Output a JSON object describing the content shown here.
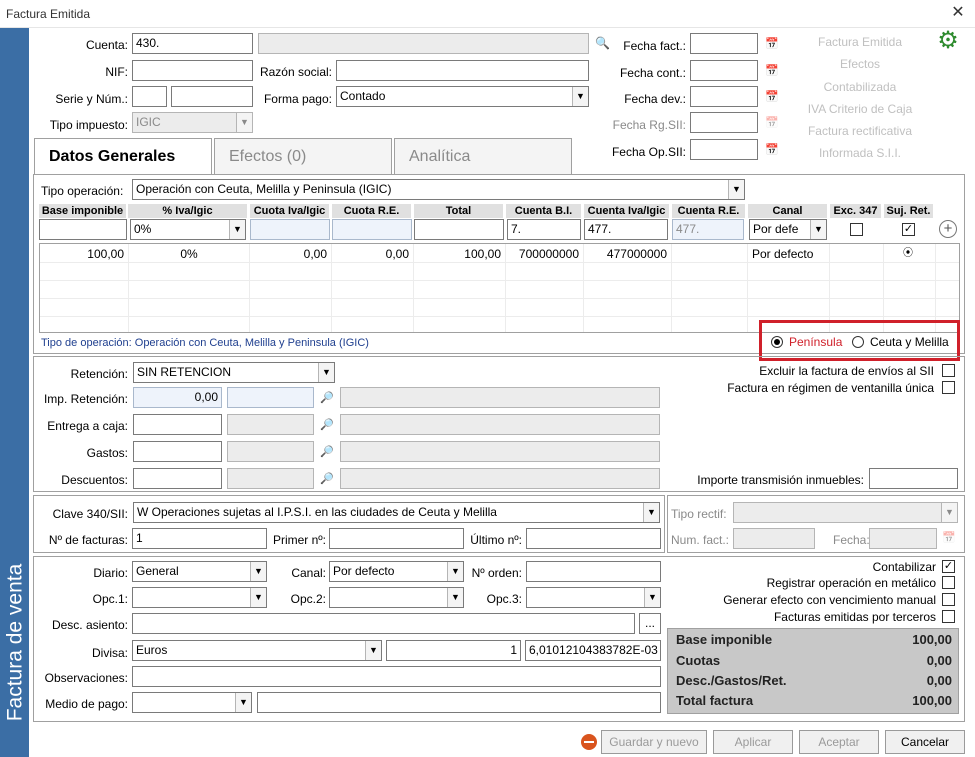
{
  "window": {
    "title": "Factura Emitida",
    "close": "✕"
  },
  "sidebar": {
    "label": "Factura de venta"
  },
  "header": {
    "cuenta_label": "Cuenta:",
    "cuenta_value": "430.",
    "nif_label": "NIF:",
    "razon_label": "Razón social:",
    "serie_label": "Serie y Núm.:",
    "forma_label": "Forma pago:",
    "forma_value": "Contado",
    "tipo_imp_label": "Tipo impuesto:",
    "tipo_imp_value": "IGIC"
  },
  "dates": {
    "fecha_fact": "Fecha  fact.:",
    "fecha_cont": "Fecha cont.:",
    "fecha_dev": "Fecha dev.:",
    "fecha_rg": "Fecha Rg.SII:",
    "fecha_op": "Fecha Op.SII:"
  },
  "right_links": [
    "Factura Emitida",
    "Efectos",
    "Contabilizada",
    "IVA Criterio de Caja",
    "Factura rectificativa",
    "Informada S.I.I."
  ],
  "tabs": [
    "Datos Generales",
    "Efectos  (0)",
    "Analítica"
  ],
  "tipo_operacion": {
    "label": "Tipo operación:",
    "value": "Operación con Ceuta, Melilla y Peninsula (IGIC)"
  },
  "grid": {
    "headers": [
      "Base imponible",
      "% Iva/Igic",
      "Cuota Iva/Igic",
      "Cuota R.E.",
      "Total",
      "Cuenta B.I.",
      "Cuenta Iva/Igic",
      "Cuenta R.E.",
      "Canal",
      "Exc. 347",
      "Suj. Ret."
    ],
    "edit": {
      "pct": "0%",
      "cuenta_bi": "7.",
      "cuenta_iva": "477.",
      "cuenta_re": "477.",
      "canal": "Por defe"
    },
    "row": [
      "100,00",
      "0%",
      "0,00",
      "0,00",
      "100,00",
      "700000000",
      "477000000",
      "Por defecto",
      "⦿"
    ]
  },
  "tipo_info": "Tipo de operación: Operación con Ceuta, Melilla y Peninsula (IGIC)",
  "radio": {
    "peninsula": "Península",
    "ceuta": "Ceuta y Melilla"
  },
  "retencion": {
    "label": "Retención:",
    "value": "SIN RETENCION",
    "imp_label": "Imp. Retención:",
    "imp_value": "0,00",
    "entrega_label": "Entrega a caja:",
    "gastos_label": "Gastos:",
    "desc_label": "Descuentos:"
  },
  "checks_mid": {
    "excluir": "Excluir la factura de envíos al SII",
    "ventanilla": "Factura en régimen de ventanilla única",
    "importe_trans": "Importe transmisión inmuebles:"
  },
  "clave": {
    "label": "Clave 340/SII:",
    "value": "W Operaciones sujetas al I.P.S.I. en las ciudades de Ceuta y Melilla",
    "nfact_label": "Nº de facturas:",
    "nfact_value": "1",
    "primer_label": "Primer nº:",
    "ultimo_label": "Último nº:",
    "tipo_rectif_label": "Tipo rectif:",
    "num_fact_label": "Num. fact.:",
    "fecha_label": "Fecha:"
  },
  "bottom": {
    "diario_label": "Diario:",
    "diario_value": "General",
    "canal_label": "Canal:",
    "canal_value": "Por defecto",
    "norden_label": "Nº orden:",
    "opc1_label": "Opc.1:",
    "opc2_label": "Opc.2:",
    "opc3_label": "Opc.3:",
    "desc_asiento_label": "Desc. asiento:",
    "divisa_label": "Divisa:",
    "divisa_value": "Euros",
    "divisa_qty": "1",
    "divisa_rate": "6,01012104383782E-03",
    "obs_label": "Observaciones:",
    "medio_label": "Medio de pago:",
    "dots": "..."
  },
  "checks_bottom": {
    "contabilizar": "Contabilizar",
    "registrar": "Registrar operación en metálico",
    "generar": "Generar efecto con vencimiento manual",
    "terceros": "Facturas emitidas por terceros"
  },
  "totals": [
    {
      "label": "Base imponible",
      "value": "100,00"
    },
    {
      "label": "Cuotas",
      "value": "0,00"
    },
    {
      "label": "Desc./Gastos/Ret.",
      "value": "0,00"
    },
    {
      "label": "Total factura",
      "value": "100,00"
    }
  ],
  "buttons": {
    "guardar": "Guardar y nuevo",
    "aplicar": "Aplicar",
    "aceptar": "Aceptar",
    "cancelar": "Cancelar"
  },
  "colors": {
    "sidebar": "#3b6ea5",
    "highlight": "#d0202a",
    "gear": "#2e8b2e"
  }
}
